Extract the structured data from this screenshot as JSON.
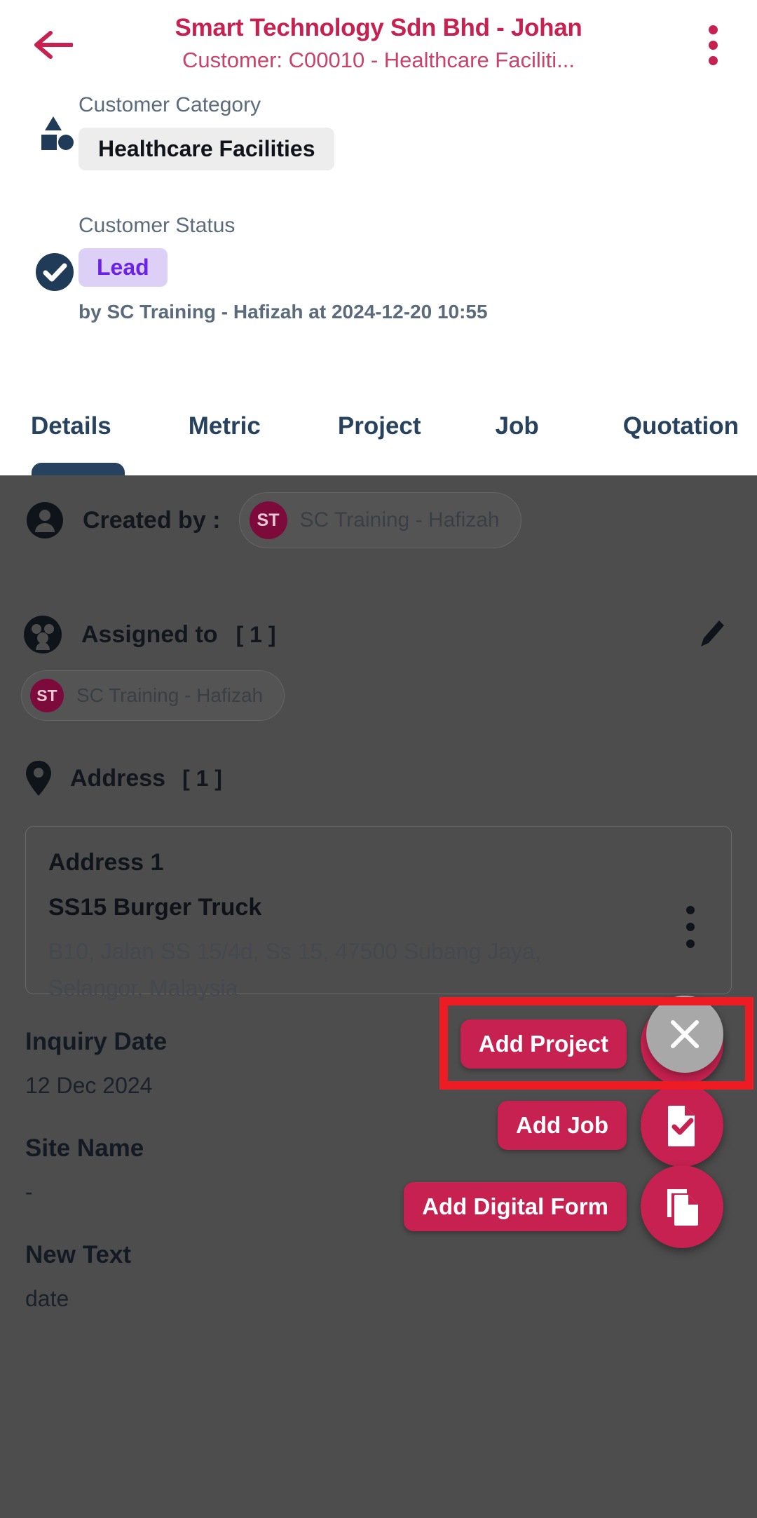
{
  "header": {
    "title": "Smart Technology Sdn Bhd - Johan",
    "subtitle": "Customer: C00010 - Healthcare Faciliti...",
    "back_icon": "arrow-left-icon",
    "menu_icon": "kebab-menu-icon"
  },
  "summary": {
    "category_label": "Customer Category",
    "category_value": "Healthcare Facilities",
    "category_icon": "shapes-icon",
    "status_label": "Customer Status",
    "status_value": "Lead",
    "status_icon": "check-circle-icon",
    "status_byline": "by SC Training - Hafizah at 2024-12-20 10:55"
  },
  "tabs": [
    {
      "label": "Details",
      "active": true
    },
    {
      "label": "Metric",
      "active": false
    },
    {
      "label": "Project",
      "active": false
    },
    {
      "label": "Job",
      "active": false
    },
    {
      "label": "Quotation",
      "active": false
    }
  ],
  "details": {
    "created_by_label": "Created by :",
    "created_by_name": "SC Training - Hafizah",
    "created_by_initials": "ST",
    "created_by_icon": "person-icon",
    "assigned_to_label": "Assigned to",
    "assigned_to_count": "[ 1 ]",
    "assigned_to_icon": "people-icon",
    "assigned_edit_icon": "pencil-icon",
    "assignee_name": "SC Training - Hafizah",
    "assignee_initials": "ST",
    "address_label": "Address",
    "address_count": "[ 1 ]",
    "address_icon": "location-pin-icon",
    "address_card_title": "Address 1",
    "address_card_name": "SS15 Burger Truck",
    "address_card_lines": "B10, Jalan SS 15/4d, Ss 15, 47500 Subang Jaya, Selangor, Malaysia",
    "address_card_menu_icon": "kebab-menu-icon",
    "inquiry_date_label": "Inquiry Date",
    "inquiry_date_value": "12 Dec 2024",
    "site_name_label": "Site Name",
    "site_name_value": "-",
    "new_text_label": "New Text",
    "new_text_value": "date"
  },
  "speed_dial": {
    "actions": [
      {
        "label": "Add Project",
        "icon": "folder-icon",
        "highlighted": true
      },
      {
        "label": "Add Job",
        "icon": "document-check-icon",
        "highlighted": false
      },
      {
        "label": "Add Digital Form",
        "icon": "copy-document-icon",
        "highlighted": false
      }
    ],
    "close_icon": "close-icon"
  },
  "colors": {
    "brand": "#C62150",
    "navy": "#27425F",
    "lead_badge_bg": "#DDD0F7",
    "lead_badge_text": "#6B21E8",
    "avatar_bg": "#7C0B3C",
    "highlight": "#ED1C24",
    "scrim": "#4D4D4D"
  }
}
